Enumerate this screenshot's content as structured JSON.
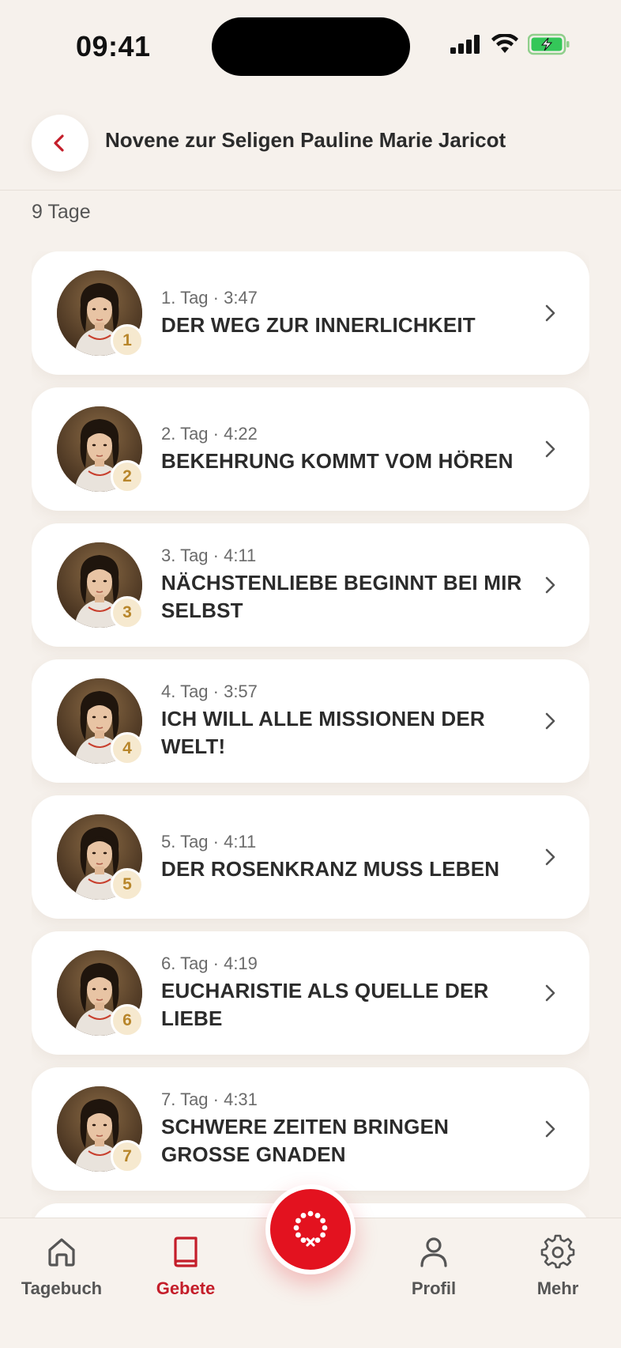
{
  "status_bar": {
    "time": "09:41"
  },
  "header": {
    "title": "Novene zur Seligen Pauline Marie Jaricot",
    "back_icon": "chevron-left-icon"
  },
  "summary": {
    "days_count": "9 Tage"
  },
  "days": [
    {
      "badge": "1",
      "meta": "1. Tag · 3:47",
      "title": "DER WEG ZUR INNERLICHKEIT"
    },
    {
      "badge": "2",
      "meta": "2. Tag · 4:22",
      "title": "BEKEHRUNG KOMMT VOM HÖREN"
    },
    {
      "badge": "3",
      "meta": "3. Tag · 4:11",
      "title": "NÄCHSTENLIEBE BEGINNT BEI MIR SELBST"
    },
    {
      "badge": "4",
      "meta": "4. Tag · 3:57",
      "title": "ICH WILL ALLE MISSIONEN DER WELT!"
    },
    {
      "badge": "5",
      "meta": "5. Tag · 4:11",
      "title": "DER ROSENKRANZ MUSS LEBEN"
    },
    {
      "badge": "6",
      "meta": "6. Tag · 4:19",
      "title": "EUCHARISTIE ALS QUELLE DER LIEBE"
    },
    {
      "badge": "7",
      "meta": "7. Tag · 4:31",
      "title": "SCHWERE ZEITEN BRINGEN GROSSE GNADEN"
    }
  ],
  "tab_bar": {
    "items": [
      {
        "label": "Tagebuch",
        "icon": "home-icon",
        "active": false
      },
      {
        "label": "Gebete",
        "icon": "book-icon",
        "active": true
      },
      {
        "label": "Profil",
        "icon": "user-icon",
        "active": false
      },
      {
        "label": "Mehr",
        "icon": "gear-icon",
        "active": false
      }
    ],
    "center_action_icon": "rosary-icon"
  },
  "colors": {
    "background": "#f6f1ec",
    "accent": "#c41e2a",
    "center_button": "#e3121f",
    "badge_background": "#f6e9cf",
    "badge_text": "#b8862b"
  }
}
